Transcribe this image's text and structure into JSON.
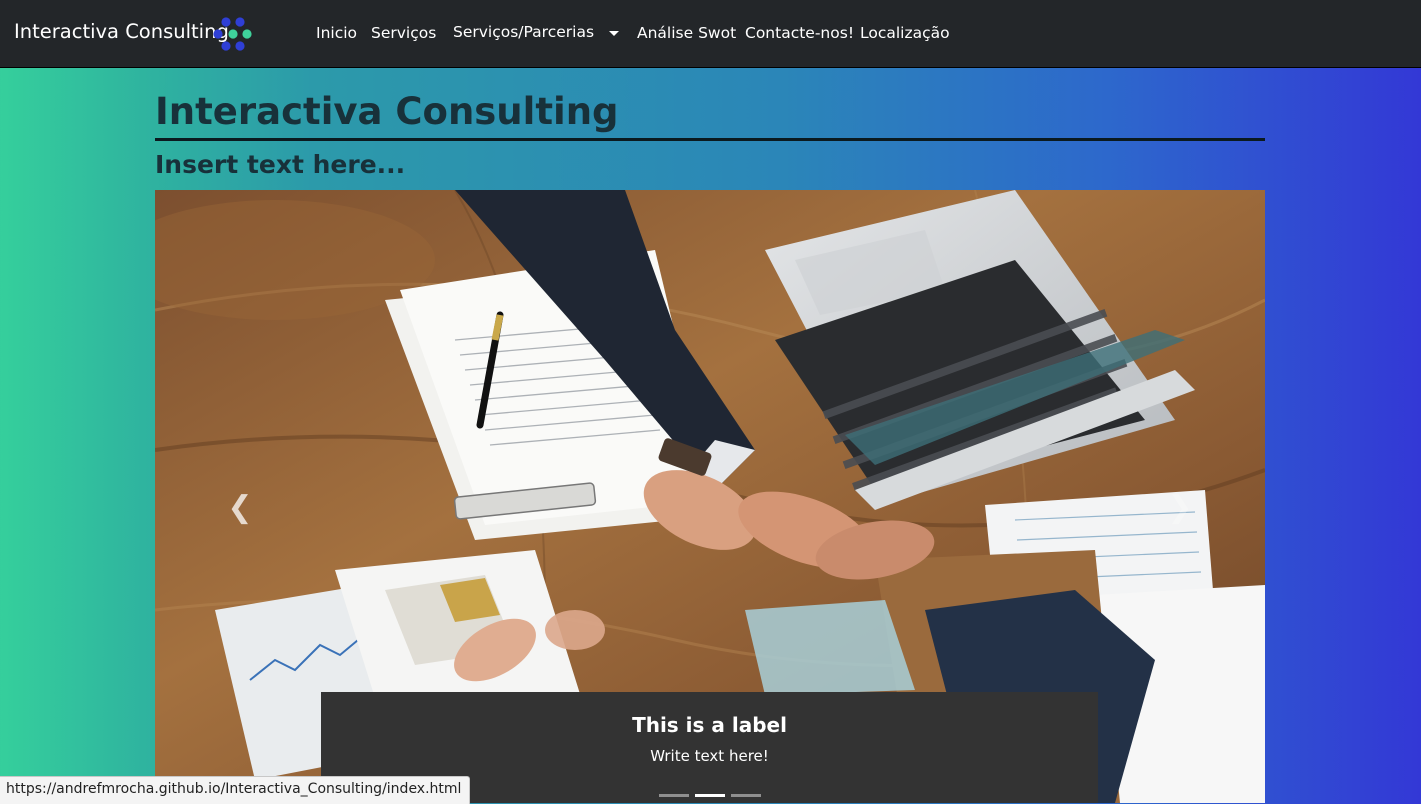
{
  "navbar": {
    "brand": "Interactiva Consulting",
    "items": [
      {
        "label": "Inicio"
      },
      {
        "label": "Serviços"
      },
      {
        "label": "Serviços/Parcerias"
      },
      {
        "label": "Análise Swot"
      },
      {
        "label": "Contacte-nos!"
      },
      {
        "label": "Localização"
      }
    ]
  },
  "header": {
    "title": "Interactiva Consulting",
    "subtitle": "Insert text here..."
  },
  "carousel": {
    "caption_title": "This is a label",
    "caption_text": "Write text here!",
    "indicator_count": 3,
    "active_indicator": 2,
    "prev_icon": "chevron-left-icon",
    "next_icon": "chevron-right-icon"
  },
  "statusbar": {
    "url": "https://andrefmrocha.github.io/Interactiva_Consulting/index.html"
  },
  "colors": {
    "navbar_bg": "#232629",
    "gradient_start": "#35cf9c",
    "gradient_end": "#3338d6",
    "logo_blue": "#2f3fd6",
    "logo_green": "#3fd19b",
    "heading_text": "#18313a",
    "caption_bg": "#333333"
  }
}
